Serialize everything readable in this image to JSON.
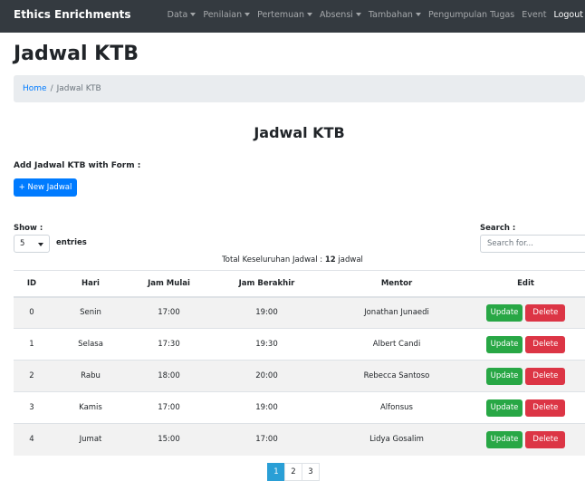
{
  "navbar": {
    "brand": "Ethics Enrichments",
    "items": [
      {
        "label": "Data",
        "dropdown": true
      },
      {
        "label": "Penilaian",
        "dropdown": true
      },
      {
        "label": "Pertemuan",
        "dropdown": true
      },
      {
        "label": "Absensi",
        "dropdown": true
      },
      {
        "label": "Tambahan",
        "dropdown": true
      },
      {
        "label": "Pengumpulan Tugas",
        "dropdown": false
      },
      {
        "label": "Event",
        "dropdown": false
      },
      {
        "label": "Logout",
        "dropdown": false
      }
    ]
  },
  "page_title": "Jadwal KTB",
  "breadcrumb": {
    "home": "Home",
    "separator": "/",
    "current": "Jadwal KTB"
  },
  "section_title": "Jadwal KTB",
  "form": {
    "label": "Add Jadwal KTB with Form :",
    "new_button": "+ New Jadwal"
  },
  "controls": {
    "show_label": "Show :",
    "entries_value": "5",
    "entries_label": "entries",
    "search_label": "Search :",
    "search_placeholder": "Search for..."
  },
  "total": {
    "prefix": "Total Keseluruhan Jadwal : ",
    "count": "12",
    "suffix": " jadwal"
  },
  "table": {
    "headers": {
      "id": "ID",
      "hari": "Hari",
      "mulai": "Jam Mulai",
      "akhir": "Jam Berakhir",
      "mentor": "Mentor",
      "edit": "Edit"
    },
    "update_label": "Update",
    "delete_label": "Delete",
    "rows": [
      {
        "id": "0",
        "hari": "Senin",
        "mulai": "17:00",
        "akhir": "19:00",
        "mentor": "Jonathan Junaedi"
      },
      {
        "id": "1",
        "hari": "Selasa",
        "mulai": "17:30",
        "akhir": "19:30",
        "mentor": "Albert Candi"
      },
      {
        "id": "2",
        "hari": "Rabu",
        "mulai": "18:00",
        "akhir": "20:00",
        "mentor": "Rebecca Santoso"
      },
      {
        "id": "3",
        "hari": "Kamis",
        "mulai": "17:00",
        "akhir": "19:00",
        "mentor": "Alfonsus"
      },
      {
        "id": "4",
        "hari": "Jumat",
        "mulai": "15:00",
        "akhir": "17:00",
        "mentor": "Lidya Gosalim"
      }
    ]
  },
  "pagination": {
    "pages": [
      "1",
      "2",
      "3"
    ],
    "active": "1"
  },
  "colors": {
    "navbar": "#343a40",
    "primary": "#007bff",
    "success": "#28a745",
    "danger": "#dc3545",
    "page_active": "#2a9fd6"
  }
}
